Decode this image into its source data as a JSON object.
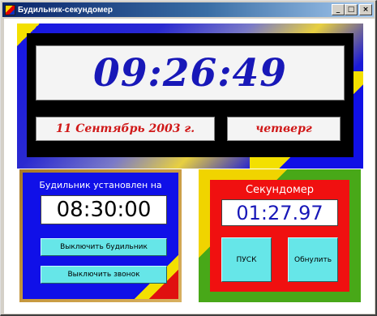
{
  "window": {
    "title": "Будильник-секундомер",
    "minimize_glyph": "_",
    "maximize_glyph": "□",
    "close_glyph": "×"
  },
  "clock": {
    "time": "09:26:49",
    "date": "11 Сентябрь 2003 г.",
    "weekday": "четверг"
  },
  "alarm": {
    "caption": "Будильник установлен на",
    "time": "08:30:00",
    "disable_alarm_label": "Выключить будильник",
    "disable_ring_label": "Выключить звонок"
  },
  "stopwatch": {
    "caption": "Секундомер",
    "time": "01:27.97",
    "start_label": "ПУСК",
    "reset_label": "Обнулить"
  },
  "colors": {
    "clock_text": "#1818b8",
    "date_text": "#d01818",
    "panel_blue": "#1010e8",
    "panel_red": "#f01010",
    "button_cyan": "#66e6e8",
    "accent_yellow": "#f3e000",
    "accent_green": "#48a818"
  }
}
